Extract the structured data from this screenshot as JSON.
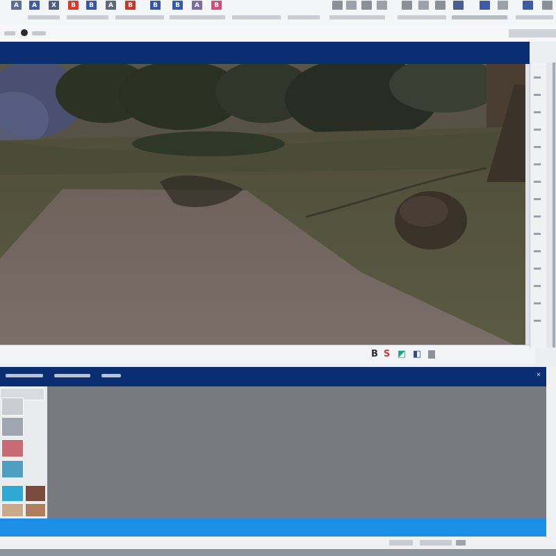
{
  "toolbar": {
    "icons": [
      {
        "name": "select-icon",
        "label": "A",
        "color": "#5a6f95"
      },
      {
        "name": "group-icon",
        "label": "A",
        "color": "#3f5c9f"
      },
      {
        "name": "scissors-icon",
        "label": "X",
        "color": "#4e5f7e"
      },
      {
        "name": "bold-icon",
        "label": "B",
        "color": "#d9372f"
      },
      {
        "name": "brush-icon",
        "label": "B",
        "color": "#3656a8"
      },
      {
        "name": "pin-icon",
        "label": "A",
        "color": "#5e6a7c"
      },
      {
        "name": "layer-icon",
        "label": "B",
        "color": "#c8362d"
      },
      {
        "name": "image-icon",
        "label": "B",
        "color": "#3455a8"
      },
      {
        "name": "frame-icon",
        "label": "B",
        "color": "#355ba8"
      },
      {
        "name": "chart-icon",
        "label": "A",
        "color": "#7a6da8"
      },
      {
        "name": "tag-icon",
        "label": "B",
        "color": "#d54a7c"
      }
    ]
  },
  "viewport": {
    "status_icons": [
      {
        "name": "bold-status-icon",
        "label": "B",
        "color": "#2b2b2b"
      },
      {
        "name": "style-status-icon",
        "label": "S",
        "color": "#c63c3c"
      },
      {
        "name": "palette-status-icon",
        "label": "◩",
        "color": "#1fa37a"
      },
      {
        "name": "fill-status-icon",
        "label": "◧",
        "color": "#334a88"
      }
    ]
  },
  "bottom_panel": {
    "close_glyph": "×"
  },
  "colors": {
    "title_bar": "#0b2e73",
    "accent_bar": "#1e8fe6",
    "content_bg": "#777a7e"
  }
}
